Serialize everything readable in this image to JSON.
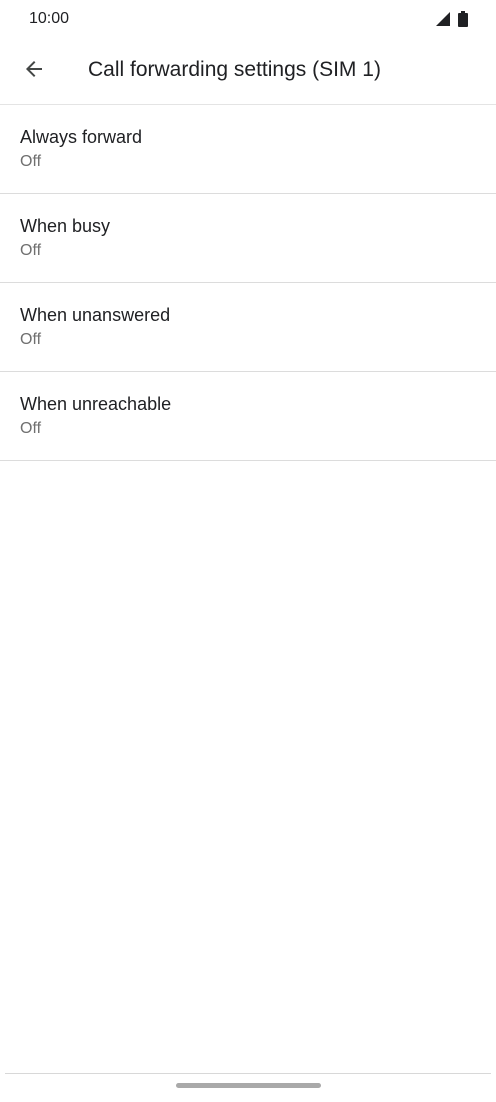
{
  "status_bar": {
    "time": "10:00",
    "icons": [
      "signal-icon",
      "battery-icon"
    ]
  },
  "app_bar": {
    "back_icon": "arrow-left-icon",
    "title": "Call forwarding settings (SIM 1)"
  },
  "items": [
    {
      "title": "Always forward",
      "summary": "Off"
    },
    {
      "title": "When busy",
      "summary": "Off"
    },
    {
      "title": "When unanswered",
      "summary": "Off"
    },
    {
      "title": "When unreachable",
      "summary": "Off"
    }
  ],
  "colors": {
    "background": "#ffffff",
    "text_primary": "#202124",
    "text_secondary": "#6f6f6f",
    "divider": "#dcdcdc"
  }
}
